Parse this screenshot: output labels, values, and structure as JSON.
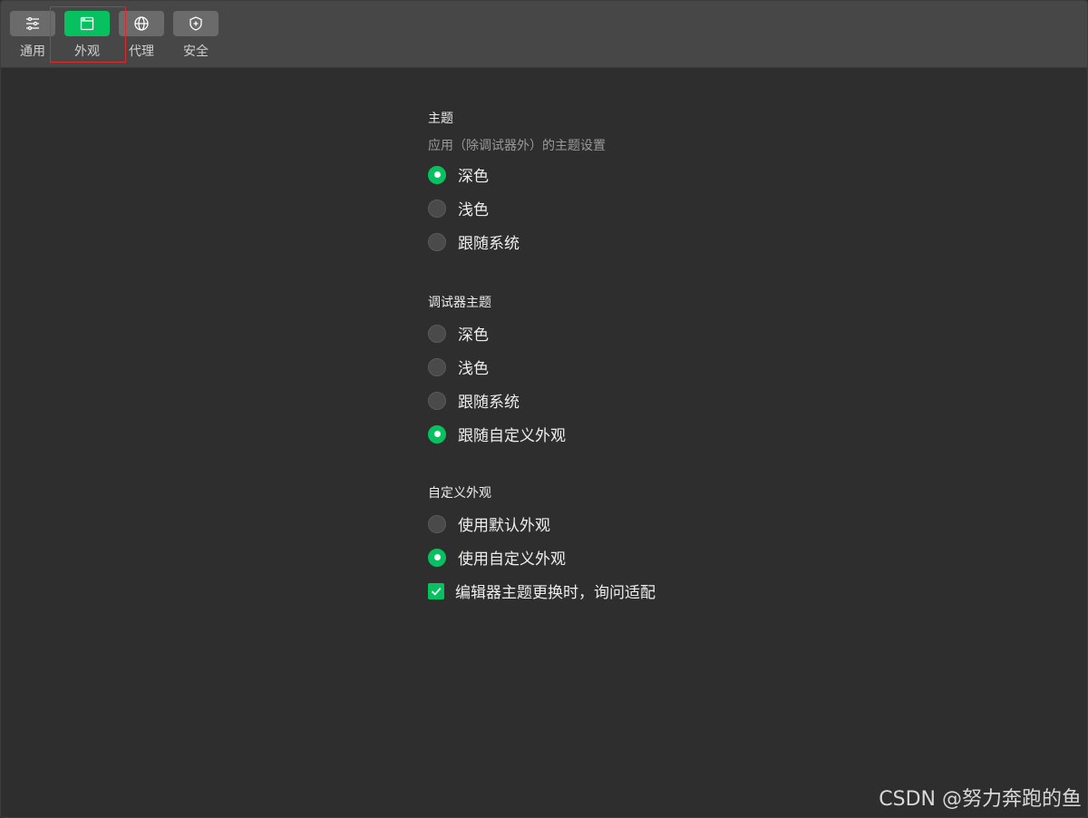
{
  "toolbar": {
    "tabs": [
      {
        "label": "通用",
        "icon": "sliders-icon"
      },
      {
        "label": "外观",
        "icon": "window-icon",
        "active": true
      },
      {
        "label": "代理",
        "icon": "globe-icon"
      },
      {
        "label": "安全",
        "icon": "shield-icon"
      }
    ]
  },
  "theme": {
    "title": "主题",
    "description": "应用（除调试器外）的主题设置",
    "options": [
      "深色",
      "浅色",
      "跟随系统"
    ],
    "selected": "深色"
  },
  "debugger_theme": {
    "title": "调试器主题",
    "options": [
      "深色",
      "浅色",
      "跟随系统",
      "跟随自定义外观"
    ],
    "selected": "跟随自定义外观"
  },
  "custom_appearance": {
    "title": "自定义外观",
    "options": [
      "使用默认外观",
      "使用自定义外观"
    ],
    "selected": "使用自定义外观",
    "checkbox_label": "编辑器主题更换时，询问适配",
    "checkbox_checked": true
  },
  "watermark": "CSDN @努力奔跑的鱼",
  "colors": {
    "accent": "#07c160",
    "highlight": "#e0282a",
    "background": "#2e2e2e",
    "toolbar": "#474747"
  }
}
